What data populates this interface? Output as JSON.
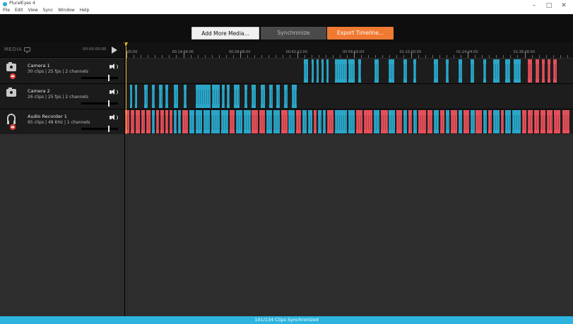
{
  "window": {
    "title": "PluralEyes 4",
    "menu": [
      "File",
      "Edit",
      "View",
      "Sync",
      "Window",
      "Help"
    ],
    "controls": {
      "minimize": "–",
      "maximize": "□",
      "close": "✕"
    }
  },
  "toolbar": {
    "add_media_label": "Add More Media...",
    "synchronize_label": "Synchronize",
    "export_label": "Export Timeline..."
  },
  "sidebar": {
    "media_label": "MEDIA",
    "media_icon": "monitor-icon",
    "playhead_time": "00:00:00:00",
    "play_icon": "play-icon"
  },
  "ruler": {
    "labels": [
      "00:00",
      "00:14:04:00",
      "00:28:08:00",
      "00:42:12:00",
      "00:56:16:00",
      "01:10:20:00",
      "01:24:24:00",
      "01:38:28:00"
    ]
  },
  "tracks": [
    {
      "name": "Camera 1",
      "meta": "30 clips | 25 fps | 2 channels",
      "icon": "camera-icon",
      "record_dot": true,
      "volume": 0.75,
      "clips": [
        {
          "start": 0.399,
          "end": 0.408,
          "color": "blue"
        },
        {
          "start": 0.416,
          "end": 0.421,
          "color": "blue"
        },
        {
          "start": 0.427,
          "end": 0.432,
          "color": "blue"
        },
        {
          "start": 0.438,
          "end": 0.443,
          "color": "blue"
        },
        {
          "start": 0.449,
          "end": 0.454,
          "color": "blue"
        },
        {
          "start": 0.468,
          "end": 0.495,
          "color": "blue"
        },
        {
          "start": 0.498,
          "end": 0.513,
          "color": "blue"
        },
        {
          "start": 0.52,
          "end": 0.527,
          "color": "blue"
        },
        {
          "start": 0.557,
          "end": 0.566,
          "color": "blue"
        },
        {
          "start": 0.589,
          "end": 0.601,
          "color": "blue"
        },
        {
          "start": 0.621,
          "end": 0.629,
          "color": "blue"
        },
        {
          "start": 0.643,
          "end": 0.65,
          "color": "blue"
        },
        {
          "start": 0.689,
          "end": 0.699,
          "color": "blue"
        },
        {
          "start": 0.716,
          "end": 0.723,
          "color": "blue"
        },
        {
          "start": 0.744,
          "end": 0.752,
          "color": "blue"
        },
        {
          "start": 0.771,
          "end": 0.779,
          "color": "blue"
        },
        {
          "start": 0.799,
          "end": 0.806,
          "color": "blue"
        },
        {
          "start": 0.822,
          "end": 0.836,
          "color": "blue"
        },
        {
          "start": 0.849,
          "end": 0.86,
          "color": "blue"
        },
        {
          "start": 0.868,
          "end": 0.883,
          "color": "blue"
        },
        {
          "start": 0.899,
          "end": 0.908,
          "color": "red"
        },
        {
          "start": 0.917,
          "end": 0.924,
          "color": "red"
        },
        {
          "start": 0.93,
          "end": 0.937,
          "color": "red"
        },
        {
          "start": 0.943,
          "end": 0.95,
          "color": "red"
        },
        {
          "start": 0.956,
          "end": 0.963,
          "color": "red"
        }
      ]
    },
    {
      "name": "Camera 2",
      "meta": "26 clips | 25 fps | 2 channels",
      "icon": "camera-icon",
      "record_dot": false,
      "volume": 0.75,
      "clips": [
        {
          "start": 0.011,
          "end": 0.016,
          "color": "blue"
        },
        {
          "start": 0.022,
          "end": 0.027,
          "color": "blue"
        },
        {
          "start": 0.042,
          "end": 0.05,
          "color": "blue"
        },
        {
          "start": 0.06,
          "end": 0.066,
          "color": "blue"
        },
        {
          "start": 0.076,
          "end": 0.084,
          "color": "blue"
        },
        {
          "start": 0.09,
          "end": 0.096,
          "color": "blue"
        },
        {
          "start": 0.109,
          "end": 0.118,
          "color": "blue"
        },
        {
          "start": 0.131,
          "end": 0.138,
          "color": "blue"
        },
        {
          "start": 0.158,
          "end": 0.191,
          "color": "blue"
        },
        {
          "start": 0.194,
          "end": 0.211,
          "color": "blue"
        },
        {
          "start": 0.216,
          "end": 0.223,
          "color": "blue"
        },
        {
          "start": 0.227,
          "end": 0.233,
          "color": "blue"
        },
        {
          "start": 0.243,
          "end": 0.256,
          "color": "blue"
        },
        {
          "start": 0.266,
          "end": 0.273,
          "color": "blue"
        },
        {
          "start": 0.282,
          "end": 0.292,
          "color": "blue"
        },
        {
          "start": 0.303,
          "end": 0.312,
          "color": "blue"
        },
        {
          "start": 0.322,
          "end": 0.33,
          "color": "blue"
        },
        {
          "start": 0.338,
          "end": 0.345,
          "color": "blue"
        },
        {
          "start": 0.355,
          "end": 0.363,
          "color": "blue"
        },
        {
          "start": 0.372,
          "end": 0.383,
          "color": "blue"
        }
      ]
    },
    {
      "name": "Audio Recorder 1",
      "meta": "95 clips | 48 KHz | 1 channels",
      "icon": "headphones-icon",
      "record_dot": true,
      "volume": 0.75,
      "clips": [
        {
          "start": 0.0,
          "end": 0.01,
          "color": "red"
        },
        {
          "start": 0.013,
          "end": 0.02,
          "color": "red"
        },
        {
          "start": 0.024,
          "end": 0.033,
          "color": "red"
        },
        {
          "start": 0.037,
          "end": 0.044,
          "color": "red"
        },
        {
          "start": 0.047,
          "end": 0.057,
          "color": "red"
        },
        {
          "start": 0.06,
          "end": 0.066,
          "color": "blue"
        },
        {
          "start": 0.069,
          "end": 0.076,
          "color": "red"
        },
        {
          "start": 0.079,
          "end": 0.087,
          "color": "red"
        },
        {
          "start": 0.09,
          "end": 0.096,
          "color": "red"
        },
        {
          "start": 0.099,
          "end": 0.106,
          "color": "red"
        },
        {
          "start": 0.109,
          "end": 0.115,
          "color": "blue"
        },
        {
          "start": 0.118,
          "end": 0.125,
          "color": "blue"
        },
        {
          "start": 0.128,
          "end": 0.14,
          "color": "red"
        },
        {
          "start": 0.143,
          "end": 0.155,
          "color": "blue"
        },
        {
          "start": 0.158,
          "end": 0.172,
          "color": "blue"
        },
        {
          "start": 0.175,
          "end": 0.19,
          "color": "blue"
        },
        {
          "start": 0.193,
          "end": 0.212,
          "color": "blue"
        },
        {
          "start": 0.215,
          "end": 0.23,
          "color": "blue"
        },
        {
          "start": 0.233,
          "end": 0.245,
          "color": "red"
        },
        {
          "start": 0.248,
          "end": 0.262,
          "color": "blue"
        },
        {
          "start": 0.265,
          "end": 0.28,
          "color": "blue"
        },
        {
          "start": 0.283,
          "end": 0.296,
          "color": "red"
        },
        {
          "start": 0.299,
          "end": 0.312,
          "color": "red"
        },
        {
          "start": 0.315,
          "end": 0.328,
          "color": "blue"
        },
        {
          "start": 0.331,
          "end": 0.345,
          "color": "blue"
        },
        {
          "start": 0.348,
          "end": 0.362,
          "color": "red"
        },
        {
          "start": 0.365,
          "end": 0.378,
          "color": "blue"
        },
        {
          "start": 0.381,
          "end": 0.393,
          "color": "red"
        },
        {
          "start": 0.396,
          "end": 0.405,
          "color": "blue"
        },
        {
          "start": 0.408,
          "end": 0.418,
          "color": "blue"
        },
        {
          "start": 0.421,
          "end": 0.428,
          "color": "red"
        },
        {
          "start": 0.431,
          "end": 0.438,
          "color": "blue"
        },
        {
          "start": 0.441,
          "end": 0.448,
          "color": "blue"
        },
        {
          "start": 0.451,
          "end": 0.465,
          "color": "red"
        },
        {
          "start": 0.468,
          "end": 0.495,
          "color": "blue"
        },
        {
          "start": 0.498,
          "end": 0.513,
          "color": "blue"
        },
        {
          "start": 0.516,
          "end": 0.53,
          "color": "red"
        },
        {
          "start": 0.533,
          "end": 0.552,
          "color": "red"
        },
        {
          "start": 0.555,
          "end": 0.568,
          "color": "blue"
        },
        {
          "start": 0.571,
          "end": 0.586,
          "color": "red"
        },
        {
          "start": 0.589,
          "end": 0.602,
          "color": "blue"
        },
        {
          "start": 0.605,
          "end": 0.618,
          "color": "red"
        },
        {
          "start": 0.621,
          "end": 0.63,
          "color": "blue"
        },
        {
          "start": 0.633,
          "end": 0.64,
          "color": "red"
        },
        {
          "start": 0.643,
          "end": 0.651,
          "color": "blue"
        },
        {
          "start": 0.654,
          "end": 0.672,
          "color": "red"
        },
        {
          "start": 0.675,
          "end": 0.686,
          "color": "red"
        },
        {
          "start": 0.689,
          "end": 0.7,
          "color": "blue"
        },
        {
          "start": 0.703,
          "end": 0.713,
          "color": "red"
        },
        {
          "start": 0.716,
          "end": 0.724,
          "color": "blue"
        },
        {
          "start": 0.727,
          "end": 0.741,
          "color": "red"
        },
        {
          "start": 0.744,
          "end": 0.753,
          "color": "blue"
        },
        {
          "start": 0.756,
          "end": 0.768,
          "color": "red"
        },
        {
          "start": 0.771,
          "end": 0.78,
          "color": "blue"
        },
        {
          "start": 0.783,
          "end": 0.796,
          "color": "red"
        },
        {
          "start": 0.799,
          "end": 0.807,
          "color": "blue"
        },
        {
          "start": 0.81,
          "end": 0.819,
          "color": "red"
        },
        {
          "start": 0.822,
          "end": 0.836,
          "color": "blue"
        },
        {
          "start": 0.839,
          "end": 0.846,
          "color": "red"
        },
        {
          "start": 0.849,
          "end": 0.861,
          "color": "blue"
        },
        {
          "start": 0.864,
          "end": 0.884,
          "color": "blue"
        },
        {
          "start": 0.887,
          "end": 0.896,
          "color": "red"
        },
        {
          "start": 0.899,
          "end": 0.91,
          "color": "red"
        },
        {
          "start": 0.913,
          "end": 0.925,
          "color": "red"
        },
        {
          "start": 0.928,
          "end": 0.938,
          "color": "red"
        },
        {
          "start": 0.941,
          "end": 0.955,
          "color": "red"
        },
        {
          "start": 0.958,
          "end": 0.972,
          "color": "red"
        },
        {
          "start": 0.976,
          "end": 0.992,
          "color": "red"
        }
      ]
    }
  ],
  "colors": {
    "synced_clip": "#2aa6c8",
    "unsynced_clip": "#e4505a",
    "accent_orange": "#f07a32",
    "playhead": "#f2b632",
    "status_bar": "#2cb3de"
  },
  "status": {
    "text": "101/134 Clips Synchronized"
  }
}
